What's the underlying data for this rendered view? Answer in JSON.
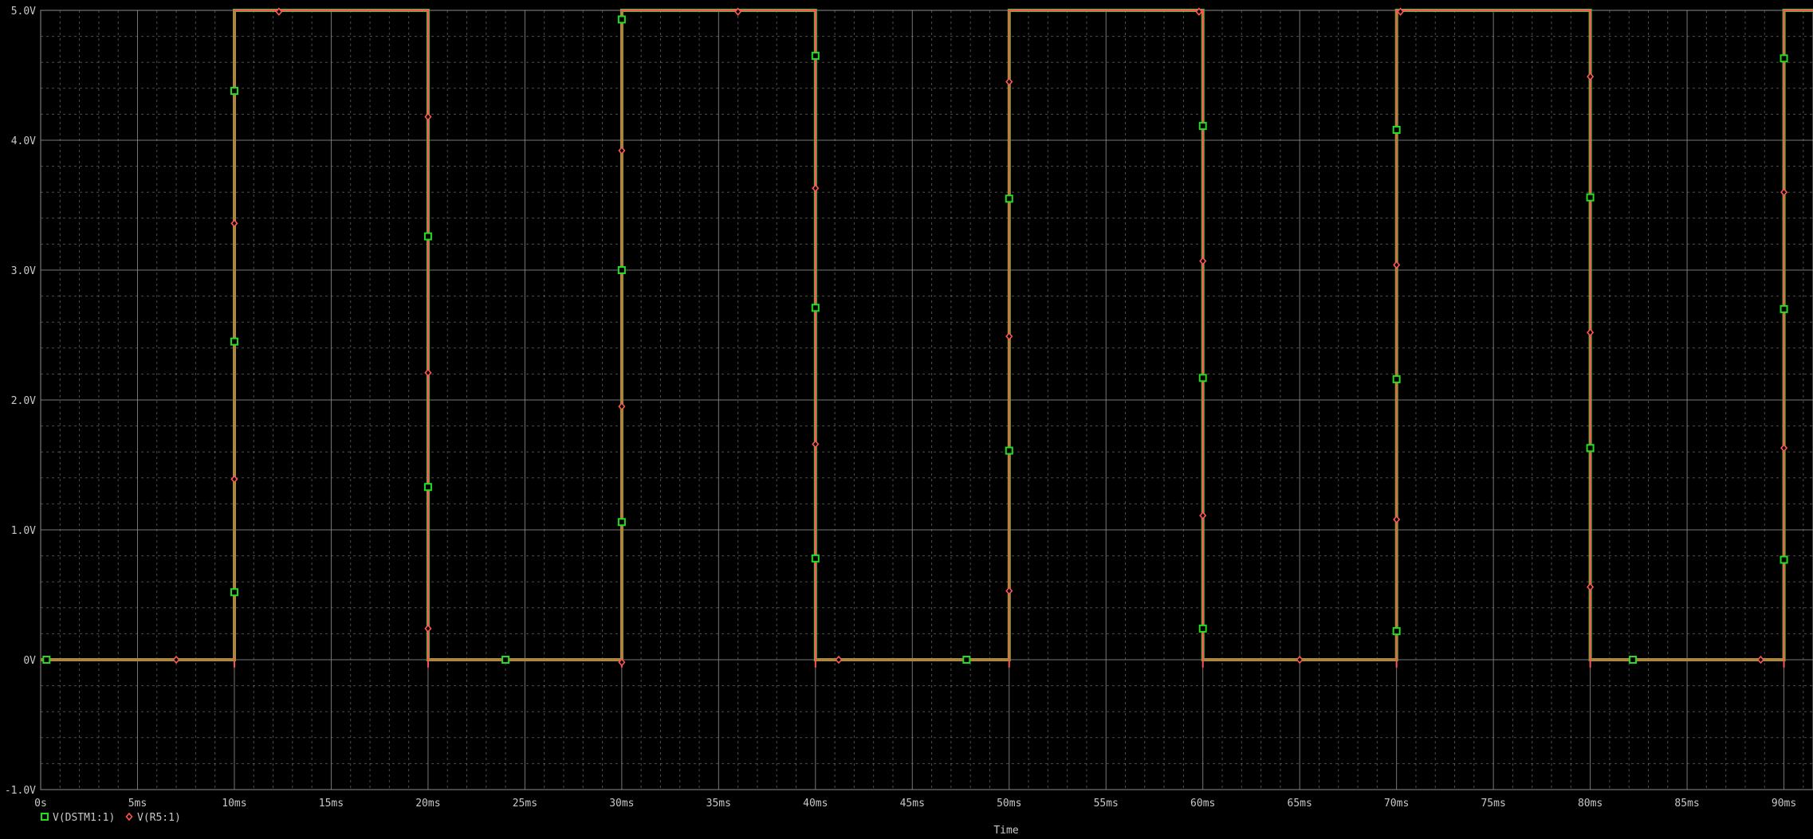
{
  "colors": {
    "background": "#000000",
    "grid": "#8c8c8c",
    "series1": "#22dd22",
    "series2": "#ff5555",
    "text": "#c8c8c8"
  },
  "chart_data": {
    "type": "line",
    "xlabel": "Time",
    "xunit": "ms",
    "xlim": [
      0,
      91.5
    ],
    "ylim": [
      -1.0,
      5.0
    ],
    "x_ticks": [
      0,
      5,
      10,
      15,
      20,
      25,
      30,
      35,
      40,
      45,
      50,
      55,
      60,
      65,
      70,
      75,
      80,
      85,
      90
    ],
    "x_tick_labels": [
      "0s",
      "5ms",
      "10ms",
      "15ms",
      "20ms",
      "25ms",
      "30ms",
      "35ms",
      "40ms",
      "45ms",
      "50ms",
      "55ms",
      "60ms",
      "65ms",
      "70ms",
      "75ms",
      "80ms",
      "85ms",
      "90ms"
    ],
    "y_ticks": [
      -1,
      0,
      1,
      2,
      3,
      4,
      5
    ],
    "y_tick_labels": [
      "-1.0V",
      "0V",
      "1.0V",
      "2.0V",
      "3.0V",
      "4.0V",
      "5.0V"
    ],
    "grid": true,
    "legend_position": "bottom-left",
    "series": [
      {
        "name": "V(DSTM1:1)",
        "marker": "square",
        "points": [
          [
            0,
            0
          ],
          [
            10,
            0
          ],
          [
            10,
            5
          ],
          [
            20,
            5
          ],
          [
            20,
            0
          ],
          [
            30,
            0
          ],
          [
            30,
            5
          ],
          [
            40,
            5
          ],
          [
            40,
            0
          ],
          [
            50,
            0
          ],
          [
            50,
            5
          ],
          [
            60,
            5
          ],
          [
            60,
            0
          ],
          [
            70,
            0
          ],
          [
            70,
            5
          ],
          [
            80,
            5
          ],
          [
            80,
            0
          ],
          [
            90,
            0
          ],
          [
            90,
            5
          ],
          [
            91.5,
            5
          ]
        ],
        "marker_points": [
          [
            0.3,
            0
          ],
          [
            10,
            4.38
          ],
          [
            10,
            2.45
          ],
          [
            10,
            0.52
          ],
          [
            20,
            3.26
          ],
          [
            20,
            1.33
          ],
          [
            24,
            0
          ],
          [
            30,
            4.93
          ],
          [
            30,
            3.0
          ],
          [
            30,
            1.06
          ],
          [
            40,
            4.65
          ],
          [
            40,
            2.71
          ],
          [
            40,
            0.78
          ],
          [
            47.8,
            0
          ],
          [
            50,
            3.55
          ],
          [
            50,
            1.61
          ],
          [
            60,
            4.11
          ],
          [
            60,
            2.17
          ],
          [
            60,
            0.24
          ],
          [
            70,
            4.08
          ],
          [
            70,
            2.16
          ],
          [
            70,
            0.22
          ],
          [
            80,
            3.56
          ],
          [
            80,
            1.63
          ],
          [
            82.2,
            0
          ],
          [
            90,
            4.63
          ],
          [
            90,
            2.7
          ],
          [
            90,
            0.77
          ]
        ]
      },
      {
        "name": "V(R5:1)",
        "marker": "diamond",
        "points": [
          [
            0,
            0
          ],
          [
            10,
            0
          ],
          [
            10,
            5
          ],
          [
            20,
            5
          ],
          [
            20,
            0
          ],
          [
            30,
            0
          ],
          [
            30,
            5
          ],
          [
            40,
            5
          ],
          [
            40,
            0
          ],
          [
            50,
            0
          ],
          [
            50,
            5
          ],
          [
            60,
            5
          ],
          [
            60,
            0
          ],
          [
            70,
            0
          ],
          [
            70,
            5
          ],
          [
            80,
            5
          ],
          [
            80,
            0
          ],
          [
            90,
            0
          ],
          [
            90,
            5
          ],
          [
            91.5,
            5
          ]
        ],
        "marker_points": [
          [
            7,
            0
          ],
          [
            10,
            3.36
          ],
          [
            10,
            1.39
          ],
          [
            12.3,
            4.99
          ],
          [
            20,
            4.18
          ],
          [
            20,
            2.21
          ],
          [
            20,
            0.24
          ],
          [
            30,
            3.92
          ],
          [
            30,
            1.95
          ],
          [
            30,
            -0.02
          ],
          [
            36,
            4.99
          ],
          [
            40,
            3.63
          ],
          [
            40,
            1.66
          ],
          [
            41.2,
            0
          ],
          [
            50,
            4.45
          ],
          [
            50,
            2.49
          ],
          [
            50,
            0.53
          ],
          [
            59.8,
            4.99
          ],
          [
            60,
            3.07
          ],
          [
            60,
            1.11
          ],
          [
            65,
            0
          ],
          [
            70,
            3.04
          ],
          [
            70,
            1.08
          ],
          [
            70.2,
            4.99
          ],
          [
            80,
            4.49
          ],
          [
            80,
            2.52
          ],
          [
            80,
            0.56
          ],
          [
            88.8,
            0
          ],
          [
            90,
            3.6
          ],
          [
            90,
            1.63
          ]
        ]
      }
    ]
  }
}
